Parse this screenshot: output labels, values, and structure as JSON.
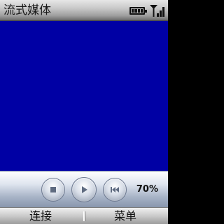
{
  "app": {
    "title": "流式媒体"
  },
  "status": {
    "battery_level": 1.0,
    "signal_strength": 1.0
  },
  "player": {
    "video_color": "#0000a4",
    "volume_text": "70%",
    "controls": [
      {
        "name": "stop-icon"
      },
      {
        "name": "play-icon"
      },
      {
        "name": "previous-icon"
      }
    ]
  },
  "softkeys": {
    "left": "连接",
    "right": "菜单"
  }
}
